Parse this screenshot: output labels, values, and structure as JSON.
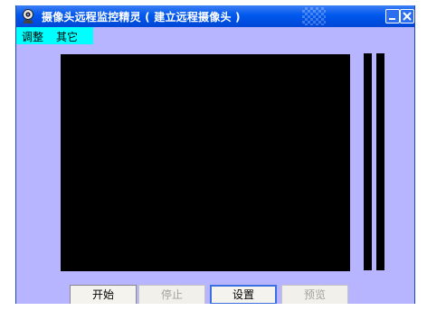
{
  "window": {
    "title": "摄像头远程监控精灵 ( 建立远程摄像头 )",
    "icon": "webcam-icon"
  },
  "menu": {
    "items": [
      {
        "label": "调整"
      },
      {
        "label": "其它"
      }
    ]
  },
  "buttons": {
    "start": "开始",
    "stop": "停止",
    "settings": "设置",
    "preview": "预览"
  },
  "colors": {
    "titlebar": "#0058ee",
    "window_background": "#b7b5ff",
    "menu_highlight": "#00ffff",
    "video_background": "#000000"
  }
}
